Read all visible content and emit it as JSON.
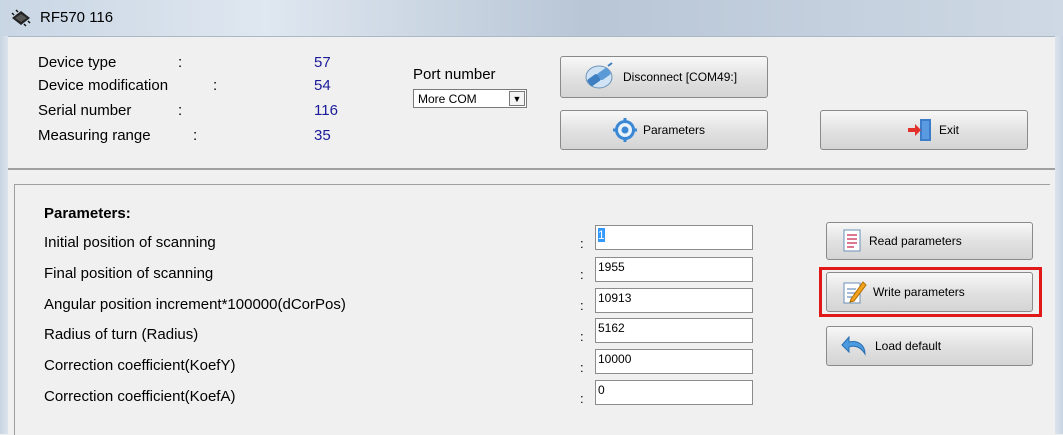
{
  "window": {
    "title": "RF570 116",
    "icon": "chip-icon"
  },
  "device": {
    "fields": [
      {
        "label": "Device type",
        "value": "57"
      },
      {
        "label": "Device modification",
        "value": "54"
      },
      {
        "label": "Serial number",
        "value": "116"
      },
      {
        "label": "Measuring range",
        "value": "35"
      }
    ],
    "colon": ":"
  },
  "port": {
    "label": "Port number",
    "selected": "More COM"
  },
  "buttons": {
    "disconnect": "Disconnect [COM49:]",
    "parameters": "Parameters",
    "exit": "Exit",
    "read": "Read parameters",
    "write": "Write parameters",
    "load_default": "Load default"
  },
  "parameters": {
    "title": "Parameters",
    "title_colon": ":",
    "rows": [
      {
        "label": "Initial position of scanning",
        "value": "1"
      },
      {
        "label": "Final position of scanning",
        "value": "1955"
      },
      {
        "label": "Angular position increment*100000(dCorPos)",
        "value": "10913"
      },
      {
        "label": "Radius of turn (Radius)",
        "value": "5162"
      },
      {
        "label": "Correction coefficient(KoefY)",
        "value": "10000"
      },
      {
        "label": "Correction coefficient(KoefA)",
        "value": "0"
      }
    ],
    "colon": ":"
  },
  "colors": {
    "highlight": "#e01818",
    "value_text": "#1a1a9a"
  }
}
